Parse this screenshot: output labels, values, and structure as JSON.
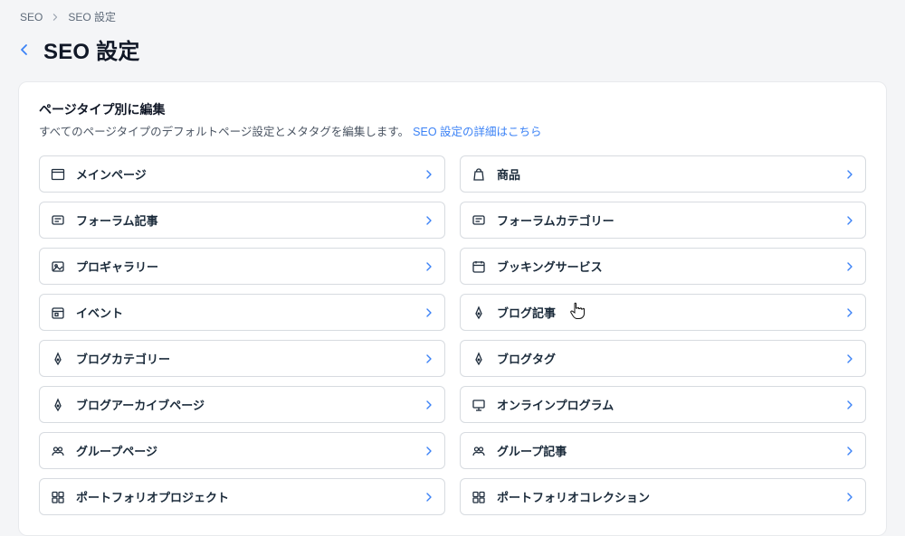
{
  "breadcrumb": {
    "root": "SEO",
    "current": "SEO 設定"
  },
  "page_title": "SEO 設定",
  "panel": {
    "title": "ページタイプ別に編集",
    "description": "すべてのページタイプのデフォルトページ設定とメタタグを編集します。",
    "learn_more": "SEO 設定の詳細はこちら"
  },
  "cards": {
    "left": [
      {
        "label": "メインページ",
        "icon": "main-page"
      },
      {
        "label": "フォーラム記事",
        "icon": "forum-post"
      },
      {
        "label": "プロギャラリー",
        "icon": "gallery"
      },
      {
        "label": "イベント",
        "icon": "event"
      },
      {
        "label": "ブログカテゴリー",
        "icon": "pen"
      },
      {
        "label": "ブログアーカイブページ",
        "icon": "pen"
      },
      {
        "label": "グループページ",
        "icon": "group"
      },
      {
        "label": "ポートフォリオプロジェクト",
        "icon": "portfolio"
      }
    ],
    "right": [
      {
        "label": "商品",
        "icon": "product"
      },
      {
        "label": "フォーラムカテゴリー",
        "icon": "forum-category"
      },
      {
        "label": "ブッキングサービス",
        "icon": "booking"
      },
      {
        "label": "ブログ記事",
        "icon": "pen"
      },
      {
        "label": "ブログタグ",
        "icon": "pen"
      },
      {
        "label": "オンラインプログラム",
        "icon": "online-program"
      },
      {
        "label": "グループ記事",
        "icon": "group"
      },
      {
        "label": "ポートフォリオコレクション",
        "icon": "portfolio"
      }
    ]
  }
}
